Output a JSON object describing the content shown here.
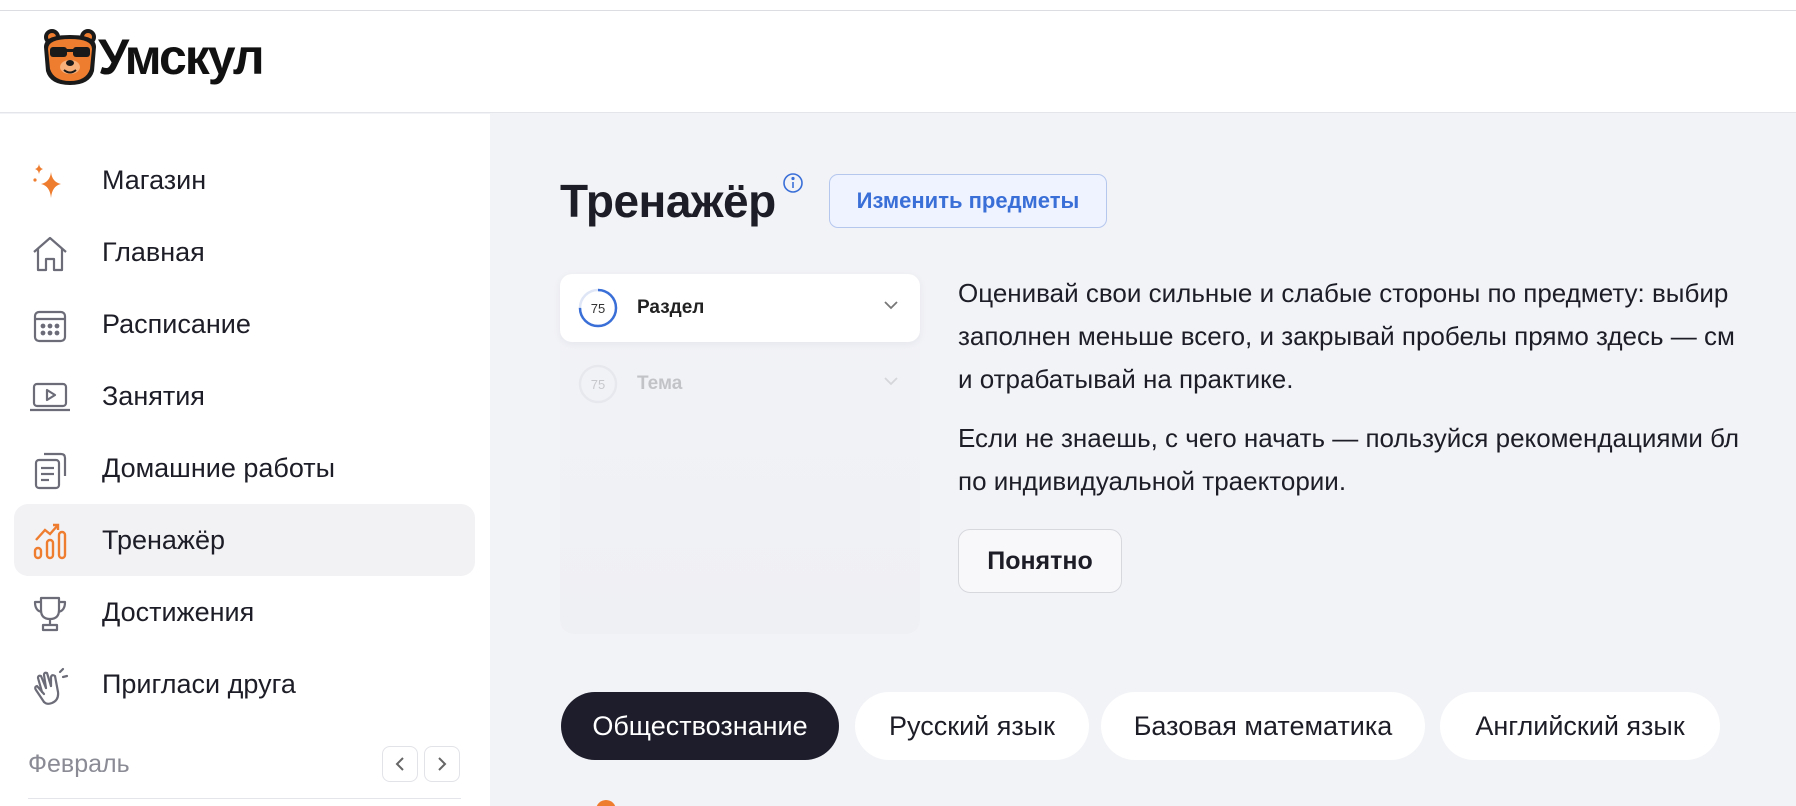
{
  "app": {
    "logo_text": "Умскул"
  },
  "sidebar": {
    "items": [
      {
        "label": "Магазин",
        "icon": "sparkle-icon"
      },
      {
        "label": "Главная",
        "icon": "home-icon"
      },
      {
        "label": "Расписание",
        "icon": "calendar-icon"
      },
      {
        "label": "Занятия",
        "icon": "laptop-play-icon"
      },
      {
        "label": "Домашние работы",
        "icon": "documents-icon"
      },
      {
        "label": "Тренажёр",
        "icon": "bar-chart-icon",
        "active": true
      },
      {
        "label": "Достижения",
        "icon": "trophy-icon"
      },
      {
        "label": "Пригласи друга",
        "icon": "clapping-hands-icon"
      }
    ],
    "month": "Февраль"
  },
  "main": {
    "title": "Тренажёр",
    "change_button": "Изменить предметы",
    "demo": {
      "row1": {
        "number": "75",
        "label": "Раздел"
      },
      "row2": {
        "number": "75",
        "label": "Тема"
      }
    },
    "description": {
      "p1_line1": "Оценивай свои сильные и слабые стороны по предмету: выбир",
      "p1_line2": "заполнен меньше всего, и закрывай пробелы прямо здесь — см",
      "p1_line3": "и отрабатывай на практике.",
      "p2_line1": "Если не знаешь, с чего начать — пользуйся рекомендациями бл",
      "p2_line2": "по индивидуальной траектории."
    },
    "ok_button": "Понятно",
    "subjects": [
      {
        "label": "Обществознание",
        "active": true
      },
      {
        "label": "Русский язык",
        "active": false
      },
      {
        "label": "Базовая математика",
        "active": false
      },
      {
        "label": "Английский язык",
        "active": false
      }
    ]
  },
  "colors": {
    "accent_orange": "#ef7d2f",
    "accent_blue": "#3a6fd8",
    "active_chip": "#1d1d2b",
    "background": "#f2f3f7"
  }
}
